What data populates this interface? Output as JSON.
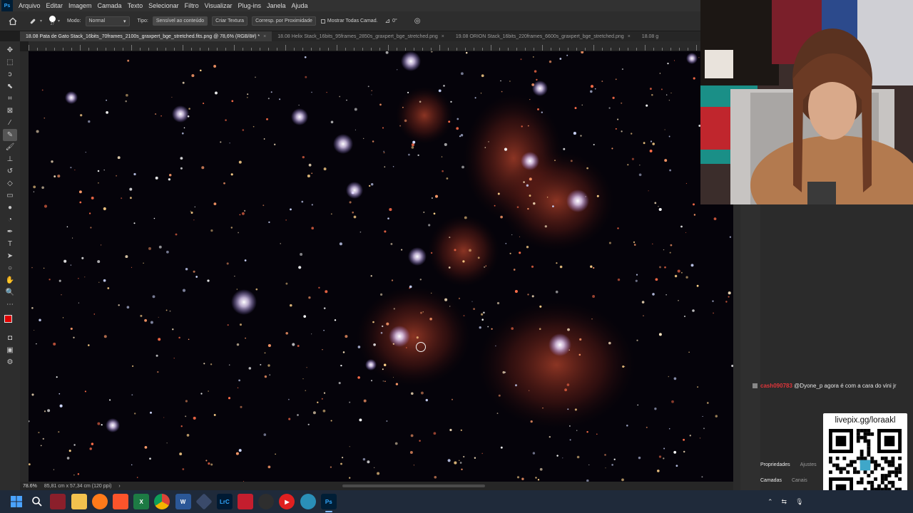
{
  "app": {
    "logo_text": "Ps"
  },
  "menu": [
    "Arquivo",
    "Editar",
    "Imagem",
    "Camada",
    "Texto",
    "Selecionar",
    "Filtro",
    "Visualizar",
    "Plug-ins",
    "Janela",
    "Ajuda"
  ],
  "options": {
    "brush_size": "27",
    "mode_label": "Modo:",
    "mode_value": "Normal",
    "type_label": "Tipo:",
    "content_aware": "Sensível ao conteúdo",
    "create_texture": "Criar Textura",
    "proximity_match": "Corresp. por Proximidade",
    "sample_all_layers": "Mostrar Todas Camad.",
    "angle_value": "0°"
  },
  "tabs": [
    {
      "label": "18.08 Pata de Gato Stack_16bits_70frames_2100s_graxpert_bge_stretched.fits.png @ 78,6% (RGB/8#) *",
      "active": true
    },
    {
      "label": "18.08 Helix Stack_16bits_95frames_2850s_graxpert_bge_stretched.png",
      "active": false
    },
    {
      "label": "19.08 ORION Stack_16bits_220frames_6600s_graxpert_bge_stretched.png",
      "active": false
    },
    {
      "label": "18.08 g",
      "active": false
    }
  ],
  "status": {
    "zoom": "78.6%",
    "doc_size": "85,81 cm x 57,34 cm (120 ppi)"
  },
  "chat": {
    "username": "cash090783",
    "message": "@Dyone_p agora é com a cara do vini jr"
  },
  "panels": {
    "tabs_top": [
      "Propriedades",
      "Ajustes"
    ],
    "tabs_bottom": [
      "Camadas",
      "Canais"
    ]
  },
  "qr": {
    "title": "livepix.gg/loraakl"
  },
  "taskbar": {
    "apps": [
      "start-icon",
      "search-icon",
      "task-app-icon",
      "file-explorer-icon",
      "firefox-icon",
      "brave-icon",
      "excel-icon",
      "chrome-icon",
      "word-icon",
      "app-diamond-icon",
      "lightroom-icon",
      "video-app-icon",
      "obs-icon",
      "youtube-icon",
      "globe-app-icon",
      "photoshop-icon"
    ],
    "lightroom_label": "LrC",
    "photoshop_label": "Ps"
  },
  "colors": {
    "foreground": "#e00000",
    "background": "#ffffff",
    "nebula": "#c0462a"
  }
}
